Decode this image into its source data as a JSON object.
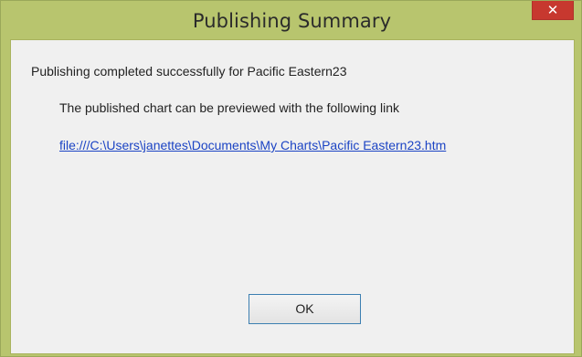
{
  "window": {
    "title": "Publishing Summary",
    "close_glyph": "✕",
    "title_color": "#b8c56e",
    "close_color": "#c7382f"
  },
  "body": {
    "message": "Publishing completed successfully for Pacific Eastern23",
    "preview_text": "The published chart can be previewed with the following link",
    "link": "file:///C:\\Users\\janettes\\Documents\\My Charts\\Pacific Eastern23.htm",
    "link_color": "#1c44c4"
  },
  "buttons": {
    "ok_label": "OK"
  }
}
